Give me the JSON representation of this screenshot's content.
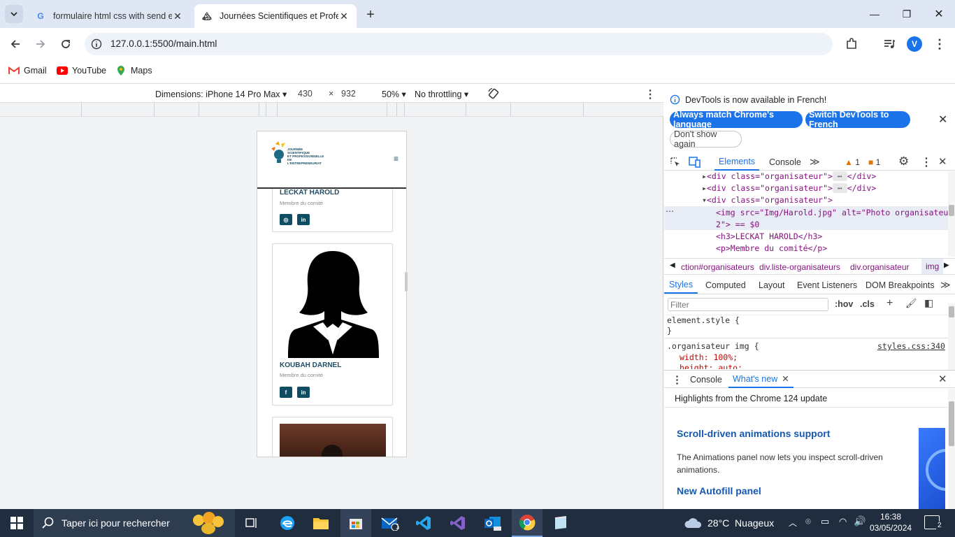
{
  "browser": {
    "tabs": [
      {
        "title": "formulaire html css with send e",
        "icon": "google-icon"
      },
      {
        "title": "Journées Scientifiques et Profes",
        "icon": "site-icon"
      }
    ],
    "url": "127.0.0.1:5500/main.html",
    "bookmarks": [
      {
        "label": "Gmail",
        "icon": "gmail-icon"
      },
      {
        "label": "YouTube",
        "icon": "youtube-icon"
      },
      {
        "label": "Maps",
        "icon": "maps-icon"
      }
    ],
    "profile_initial": "V"
  },
  "device_toolbar": {
    "dimensions": "Dimensions: iPhone 14 Pro Max",
    "width": "430",
    "times": "×",
    "height": "932",
    "zoom": "50%",
    "throttling": "No throttling"
  },
  "page": {
    "logo_lines": [
      "JOURNÉE",
      "SCIENTIFIQUE",
      "ET PROFESSIONNELLE",
      "DE L'ENTREPRENEURIAT"
    ],
    "menu_glyph": "≡",
    "organisers": [
      {
        "name": "LECKAT HAROLD",
        "role": "Membre du comité",
        "socials": [
          "instagram-icon",
          "linkedin-icon"
        ]
      },
      {
        "name": "KOUBAH DARNEL",
        "role": "Membre du comité",
        "socials": [
          "facebook-icon",
          "linkedin-icon"
        ]
      }
    ]
  },
  "devtools": {
    "banner": {
      "message": "DevTools is now available in French!",
      "btn_match": "Always match Chrome's language",
      "btn_switch": "Switch DevTools to French",
      "btn_dont_show": "Don't show again"
    },
    "main_tabs": [
      "Elements",
      "Console"
    ],
    "warnings": "1",
    "errors": "1",
    "dom_lines": [
      "<div class=\"organisateur\">",
      "<div class=\"organisateur\">",
      "<div class=\"organisateur\">",
      "<img src=\"Img/Harold.jpg\" alt=\"Photo organisateur",
      "2\"> == $0",
      "<h3>LECKAT HAROLD</h3>",
      "<p>Membre du comité</p>"
    ],
    "dom_ellipsis": "</div>",
    "breadcrumbs": [
      "ction#organisateurs",
      "div.liste-organisateurs",
      "div.organisateur",
      "img"
    ],
    "style_tabs": [
      "Styles",
      "Computed",
      "Layout",
      "Event Listeners",
      "DOM Breakpoints"
    ],
    "filter_placeholder": "Filter",
    "hov": ":hov",
    "cls": ".cls",
    "styles": {
      "element_style": "element.style {",
      "close_brace": "}",
      "selector": ".organisateur img {",
      "source": "styles.css:340",
      "prop1": "width: 100%;",
      "prop2": "height: auto;"
    },
    "drawer_tabs": [
      "Console",
      "What's new"
    ],
    "whats_new": {
      "highlight": "Highlights from the Chrome 124 update",
      "h1": "Scroll-driven animations support",
      "p1": "The Animations panel now lets you inspect scroll-driven animations.",
      "h2": "New Autofill panel"
    }
  },
  "taskbar": {
    "search_placeholder": "Taper ici pour rechercher",
    "weather": "28°C  Nuageux",
    "time": "16:38",
    "date": "03/05/2024",
    "notification_count": "2",
    "mail_badge": "1"
  },
  "colors": {
    "accent": "#1a73e8",
    "teal": "#0f4d63",
    "taskbar": "#1f2d3f"
  }
}
